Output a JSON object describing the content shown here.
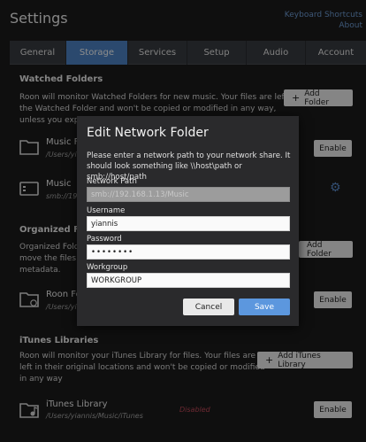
{
  "header": {
    "title": "Settings",
    "links": [
      "Keyboard Shortcuts",
      "About"
    ]
  },
  "tabs": [
    {
      "label": "General",
      "active": false
    },
    {
      "label": "Storage",
      "active": true
    },
    {
      "label": "Services",
      "active": false
    },
    {
      "label": "Setup",
      "active": false
    },
    {
      "label": "Audio",
      "active": false
    },
    {
      "label": "Account",
      "active": false
    }
  ],
  "watched": {
    "heading": "Watched Folders",
    "line1": "Roon will monitor Watched Folders for new music. Your files are left in",
    "line2": "the Watched Folder and won't be copied or modified in any way,",
    "line3": "unless you explicitly choose to edit them from within Roon.",
    "add_button": "Add Folder",
    "folders": [
      {
        "name": "Music Folder",
        "path": "/Users/yiannis/Music",
        "enable_label": "Enable"
      },
      {
        "name": "Music",
        "path": "smb://192.168.1.13/Music"
      }
    ]
  },
  "organized": {
    "heading": "Organized Folder",
    "line1": "Organized Folder lets Roon",
    "line2": "move the files a",
    "line3": "metadata.",
    "add_button": "Add Folder",
    "folder": {
      "name": "Roon Folder",
      "path": "/Users/yiannis/Music/Roon",
      "enable_label": "Enable"
    }
  },
  "itunes": {
    "heading": "iTunes Libraries",
    "line1": "Roon will monitor your iTunes Library for files. Your files are",
    "line2": "left in their original locations and won't be copied or modified",
    "line3": "in any way",
    "add_button": "Add iTunes Library",
    "library": {
      "name": "iTunes Library",
      "path": "/Users/yiannis/Music/iTunes",
      "status": "Disabled",
      "enable_label": "Enable"
    }
  },
  "dialog": {
    "title": "Edit Network Folder",
    "desc_line1": "Please enter a network path to your network share. It",
    "desc_line2": "should look something like \\\\host\\path or smb://host/path",
    "network_path_label": "Network Path",
    "network_path_value": "smb://192.168.1.13/Music",
    "username_label": "Username",
    "username_value": "yiannis",
    "password_label": "Password",
    "password_value": "••••••••",
    "workgroup_label": "Workgroup",
    "workgroup_value": "WORKGROUP",
    "cancel_label": "Cancel",
    "save_label": "Save"
  },
  "colors": {
    "accent": "#4f86c8",
    "save_button": "#5c97de",
    "disabled_text": "#c34a5a",
    "background": "#1d1d1d"
  }
}
